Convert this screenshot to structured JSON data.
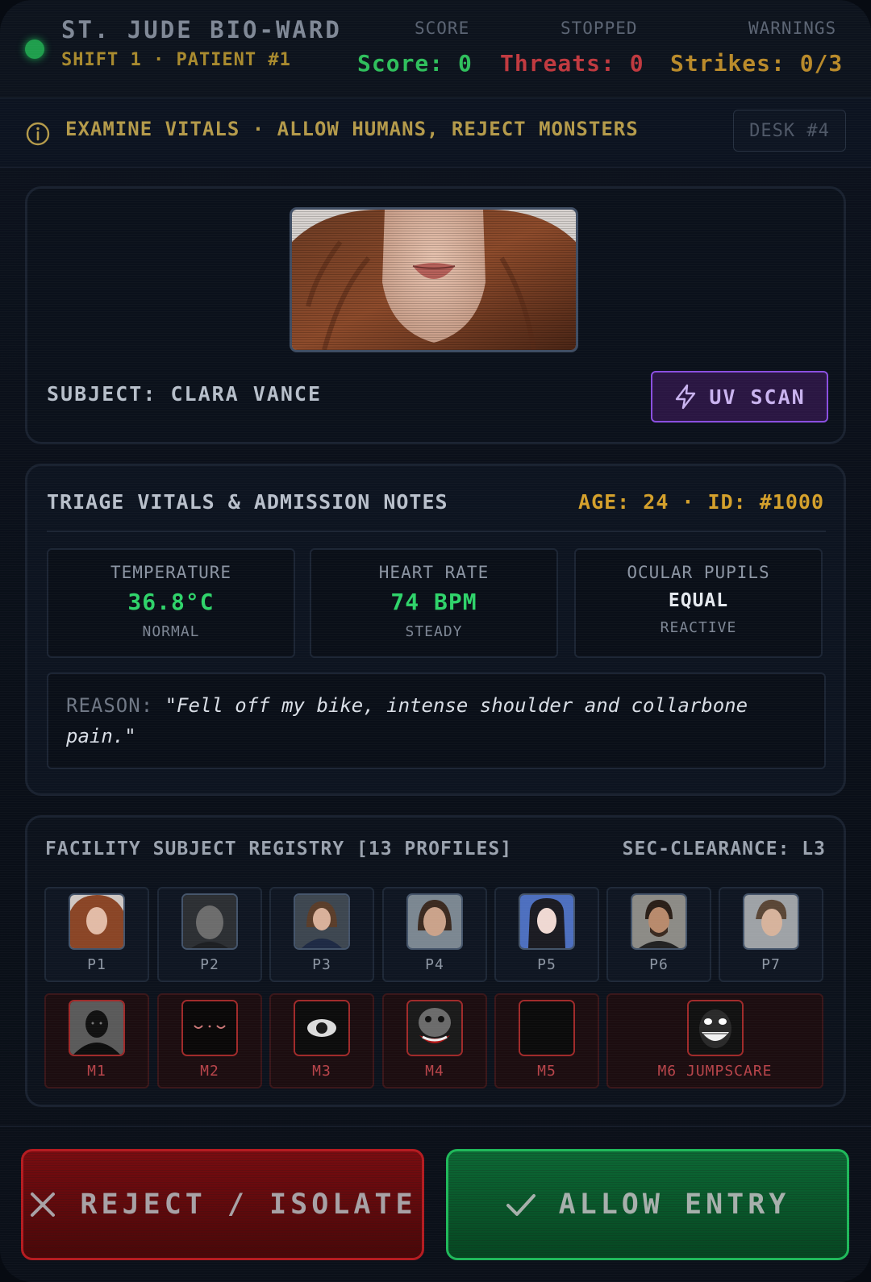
{
  "header": {
    "title": "ST. JUDE BIO-WARD",
    "subtitle": "SHIFT 1 · PATIENT #1",
    "stats": [
      {
        "label": "SCORE",
        "value": "Score: 0",
        "color": "#2fbf5c"
      },
      {
        "label": "STOPPED",
        "value": "Threats: 0",
        "color": "#c0393f"
      },
      {
        "label": "WARNINGS",
        "value": "Strikes: 0/3",
        "color": "#b98a2a"
      }
    ]
  },
  "instruction": {
    "text": "EXAMINE VITALS · ALLOW HUMANS, REJECT MONSTERS",
    "icon": "info-icon",
    "desk": "DESK #4"
  },
  "subject": {
    "name_line": "SUBJECT: CLARA VANCE",
    "uv_scan_label": "UV SCAN",
    "uv_icon": "lightning-icon"
  },
  "vitals": {
    "title": "TRIAGE VITALS & ADMISSION NOTES",
    "meta": "AGE: 24 · ID: #1000",
    "cards": [
      {
        "label": "TEMPERATURE",
        "value": "36.8°C",
        "sub": "NORMAL"
      },
      {
        "label": "HEART RATE",
        "value": "74 BPM",
        "sub": "STEADY"
      },
      {
        "label": "OCULAR PUPILS",
        "value": "EQUAL",
        "sub": "REACTIVE"
      }
    ],
    "reason_label": "REASON:",
    "reason_text": "\"Fell off my bike, intense shoulder and collarbone pain.\""
  },
  "registry": {
    "title": "FACILITY SUBJECT REGISTRY [13 PROFILES]",
    "clearance": "SEC-CLEARANCE: L3",
    "humans": [
      "P1",
      "P2",
      "P3",
      "P4",
      "P5",
      "P6",
      "P7"
    ],
    "monsters": [
      "M1",
      "M2",
      "M3",
      "M4",
      "M5",
      "M6 JUMPSCARE"
    ]
  },
  "actions": {
    "reject_label": "REJECT / ISOLATE",
    "allow_label": "ALLOW ENTRY",
    "reject_icon": "close-icon",
    "allow_icon": "check-icon"
  },
  "colors": {
    "accent_gold": "#d4a02b",
    "vital_green": "#2fd36a",
    "uv_purple": "#8a4fe0",
    "reject_red": "#b51b20",
    "allow_green": "#1fb85a"
  }
}
